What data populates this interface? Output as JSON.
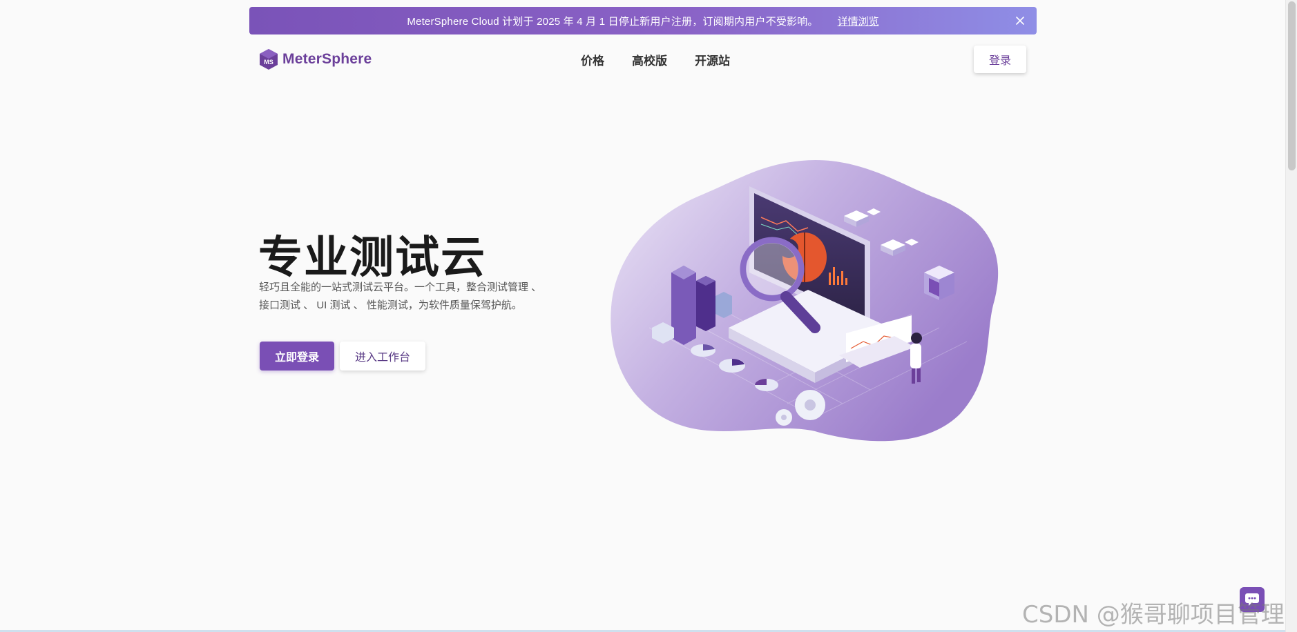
{
  "banner": {
    "text": "MeterSphere Cloud 计划于 2025 年 4 月 1 日停止新用户注册，订阅期内用户不受影响。",
    "link_label": "详情浏览",
    "close_icon": "close-icon"
  },
  "header": {
    "logo_text": "MeterSphere",
    "logo_mark_text": "MS",
    "nav": [
      {
        "label": "价格"
      },
      {
        "label": "高校版"
      },
      {
        "label": "开源站"
      }
    ],
    "login_label": "登录"
  },
  "hero": {
    "title": "专业测试云",
    "desc_line1": "轻巧且全能的一站式测试云平台。一个工具，整合测试管理 、",
    "desc_line2": "接口测试 、 UI 测试 、 性能测试，为软件质量保驾护航。",
    "primary_button": "立即登录",
    "secondary_button": "进入工作台"
  },
  "watermark": "CSDN @猴哥聊项目管理",
  "colors": {
    "brand": "#7a4fb5",
    "brand_dark": "#6b3f9a",
    "banner_start": "#7a53b8",
    "banner_end": "#8f8ee6",
    "illustration_blob": "#a389cf"
  },
  "icons": {
    "logo": "metersphere-cube-logo",
    "chat": "chat-bubble-icon",
    "illustration": "testing-dashboard-illustration"
  }
}
